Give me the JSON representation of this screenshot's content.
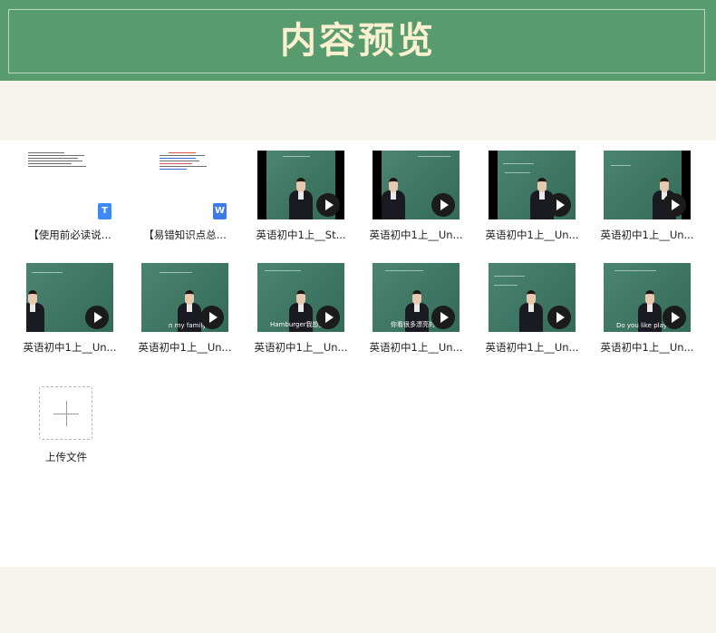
{
  "header": {
    "title": "内容预览"
  },
  "files": [
    {
      "name": "【使用前必读说...",
      "kind": "doc",
      "badge": "T"
    },
    {
      "name": "【易错知识点总...",
      "kind": "doc",
      "badge": "W"
    },
    {
      "name": "英语初中1上__St...",
      "kind": "video",
      "subtitle": ""
    },
    {
      "name": "英语初中1上__Un...",
      "kind": "video",
      "subtitle": ""
    },
    {
      "name": "英语初中1上__Un...",
      "kind": "video",
      "subtitle": ""
    },
    {
      "name": "英语初中1上__Un...",
      "kind": "video",
      "subtitle": ""
    },
    {
      "name": "英语初中1上__Un...",
      "kind": "video",
      "subtitle": ""
    },
    {
      "name": "英语初中1上__Un...",
      "kind": "video",
      "subtitle": "n my family"
    },
    {
      "name": "英语初中1上__Un...",
      "kind": "video",
      "subtitle": "Hamburger我想要了"
    },
    {
      "name": "英语初中1上__Un...",
      "kind": "video",
      "subtitle": "你看很多漂亮的衣服"
    },
    {
      "name": "英语初中1上__Un...",
      "kind": "video",
      "subtitle": ""
    },
    {
      "name": "英语初中1上__Un...",
      "kind": "video",
      "subtitle": "Do you like playing s"
    }
  ],
  "upload": {
    "label": "上传文件"
  },
  "icons": {
    "play": "play-icon",
    "text_doc": "text-document-icon",
    "word_doc": "word-document-icon",
    "add": "plus-icon"
  },
  "colors": {
    "banner": "#579b6f",
    "title_text": "#fbf0cf",
    "background": "#f7f4ee"
  }
}
